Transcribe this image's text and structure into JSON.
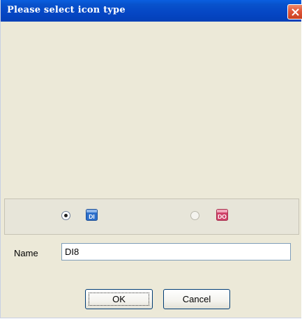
{
  "dialog": {
    "title": "Please select icon type",
    "close_icon": "close-x-icon"
  },
  "icon_type": {
    "options": [
      {
        "id": "DI",
        "icon_label": "DI",
        "icon_color": "#2d6fcb",
        "selected": true
      },
      {
        "id": "DO",
        "icon_label": "DO",
        "icon_color": "#d0436a",
        "selected": false
      }
    ]
  },
  "name_field": {
    "label": "Name",
    "value": "DI8"
  },
  "buttons": {
    "ok": "OK",
    "cancel": "Cancel"
  },
  "colors": {
    "titlebar": "#0546c4",
    "dialog_bg": "#ece9d8",
    "close_button": "#e0563a"
  }
}
